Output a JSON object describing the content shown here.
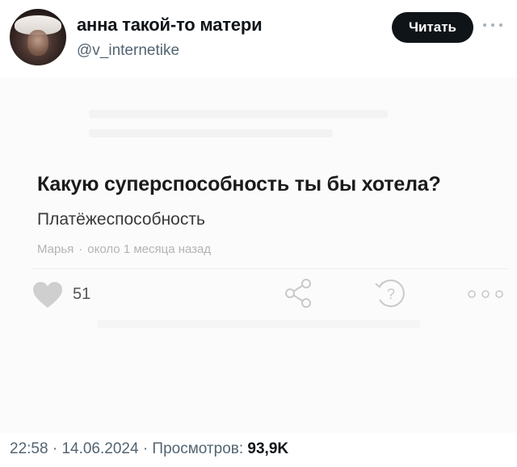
{
  "tweet": {
    "author_name": "анна такой-то матери",
    "author_handle": "@v_internetike",
    "follow_label": "Читать",
    "avatar_icon": "avatar-photo"
  },
  "embed": {
    "question": "Какую суперспособность ты бы хотела?",
    "answer": "Платёжеспособность",
    "author": "Марья",
    "separator": "·",
    "time": "около 1 месяца назад",
    "likes": "51",
    "icons": [
      "heart-icon",
      "share-icon",
      "help-icon",
      "more-icon"
    ]
  },
  "footer": {
    "time": "22:58",
    "sep1": "·",
    "date": "14.06.2024",
    "sep2": "·",
    "views_label": "Просмотров:",
    "views_value": "93,9K"
  },
  "colors": {
    "text_primary": "#0f1419",
    "text_secondary": "#536471",
    "button_bg": "#0f1419",
    "icon_gray": "#c9c9c9"
  }
}
